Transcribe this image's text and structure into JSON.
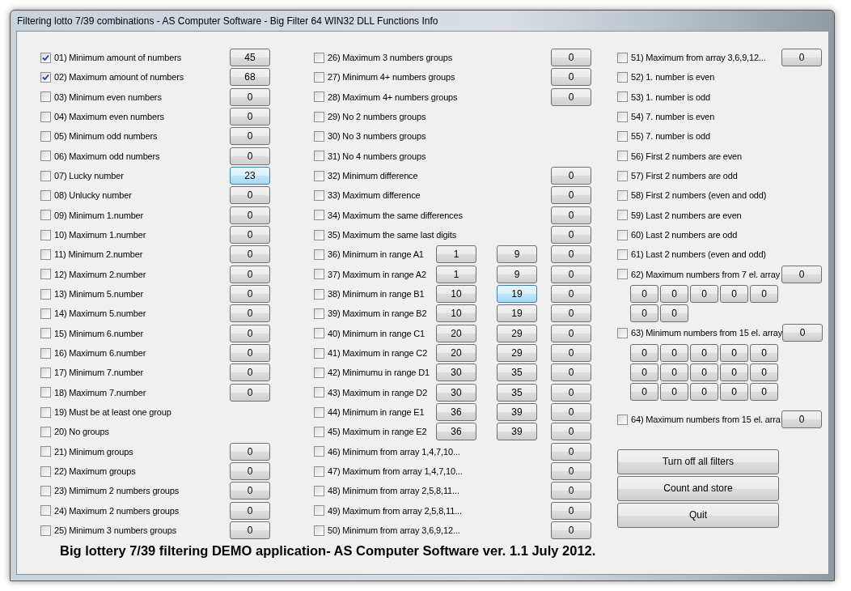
{
  "window": {
    "title": "Filtering lotto 7/39 combinations - AS Computer Software - Big Filter 64 WIN32 DLL Functions Info"
  },
  "columns": [
    {
      "items": [
        {
          "kind": "filter",
          "label": "01) Minimum amount of numbers",
          "checked": true,
          "values": [
            {
              "text": "45",
              "highlighted": false
            }
          ]
        },
        {
          "kind": "filter",
          "label": "02) Maximum amount of numbers",
          "checked": true,
          "values": [
            {
              "text": "68",
              "highlighted": false
            }
          ]
        },
        {
          "kind": "filter",
          "label": "03) Minimum even numbers",
          "checked": false,
          "values": [
            {
              "text": "0",
              "highlighted": false
            }
          ]
        },
        {
          "kind": "filter",
          "label": "04) Maximum even numbers",
          "checked": false,
          "values": [
            {
              "text": "0",
              "highlighted": false
            }
          ]
        },
        {
          "kind": "filter",
          "label": "05) Minimum odd numbers",
          "checked": false,
          "values": [
            {
              "text": "0",
              "highlighted": false
            }
          ]
        },
        {
          "kind": "filter",
          "label": "06) Maximum odd numbers",
          "checked": false,
          "values": [
            {
              "text": "0",
              "highlighted": false
            }
          ]
        },
        {
          "kind": "filter",
          "label": "07) Lucky number",
          "checked": false,
          "values": [
            {
              "text": "23",
              "highlighted": true
            }
          ]
        },
        {
          "kind": "filter",
          "label": "08) Unlucky number",
          "checked": false,
          "values": [
            {
              "text": "0",
              "highlighted": false
            }
          ]
        },
        {
          "kind": "filter",
          "label": "09) Minimum 1.number",
          "checked": false,
          "values": [
            {
              "text": "0",
              "highlighted": false
            }
          ]
        },
        {
          "kind": "filter",
          "label": "10) Maximum 1.number",
          "checked": false,
          "values": [
            {
              "text": "0",
              "highlighted": false
            }
          ]
        },
        {
          "kind": "filter",
          "label": "11) Minimum 2.number",
          "checked": false,
          "values": [
            {
              "text": "0",
              "highlighted": false
            }
          ]
        },
        {
          "kind": "filter",
          "label": "12) Maximum 2.number",
          "checked": false,
          "values": [
            {
              "text": "0",
              "highlighted": false
            }
          ]
        },
        {
          "kind": "filter",
          "label": "13) Minimum 5.number",
          "checked": false,
          "values": [
            {
              "text": "0",
              "highlighted": false
            }
          ]
        },
        {
          "kind": "filter",
          "label": "14) Maximum 5.number",
          "checked": false,
          "values": [
            {
              "text": "0",
              "highlighted": false
            }
          ]
        },
        {
          "kind": "filter",
          "label": "15) Minimum 6.number",
          "checked": false,
          "values": [
            {
              "text": "0",
              "highlighted": false
            }
          ]
        },
        {
          "kind": "filter",
          "label": "16) Maximum 6.number",
          "checked": false,
          "values": [
            {
              "text": "0",
              "highlighted": false
            }
          ]
        },
        {
          "kind": "filter",
          "label": "17) Minimum 7.number",
          "checked": false,
          "values": [
            {
              "text": "0",
              "highlighted": false
            }
          ]
        },
        {
          "kind": "filter",
          "label": "18) Maximum 7.number",
          "checked": false,
          "values": [
            {
              "text": "0",
              "highlighted": false
            }
          ]
        },
        {
          "kind": "filter",
          "label": "19) Must be at least one group",
          "checked": false
        },
        {
          "kind": "filter",
          "label": "20) No groups",
          "checked": false
        },
        {
          "kind": "filter",
          "label": "21) Minimum groups",
          "checked": false,
          "values": [
            {
              "text": "0",
              "highlighted": false
            }
          ]
        },
        {
          "kind": "filter",
          "label": "22) Maximum groups",
          "checked": false,
          "values": [
            {
              "text": "0",
              "highlighted": false
            }
          ]
        },
        {
          "kind": "filter",
          "label": "23) Mimimum 2 numbers groups",
          "checked": false,
          "values": [
            {
              "text": "0",
              "highlighted": false
            }
          ]
        },
        {
          "kind": "filter",
          "label": "24) Maximum 2 numbers groups",
          "checked": false,
          "values": [
            {
              "text": "0",
              "highlighted": false
            }
          ]
        },
        {
          "kind": "filter",
          "label": "25) Minimum 3 numbers groups",
          "checked": false,
          "values": [
            {
              "text": "0",
              "highlighted": false
            }
          ]
        }
      ]
    },
    {
      "items": [
        {
          "kind": "filter",
          "label": "26) Maximum 3 numbers groups",
          "checked": false,
          "values": [
            {
              "text": "0",
              "highlighted": false
            }
          ]
        },
        {
          "kind": "filter",
          "label": "27) Minimum 4+ numbers groups",
          "checked": false,
          "values": [
            {
              "text": "0",
              "highlighted": false
            }
          ]
        },
        {
          "kind": "filter",
          "label": "28) Maximum 4+ numbers groups",
          "checked": false,
          "values": [
            {
              "text": "0",
              "highlighted": false
            }
          ]
        },
        {
          "kind": "filter",
          "label": "29) No 2 numbers groups",
          "checked": false
        },
        {
          "kind": "filter",
          "label": "30) No 3 numbers groups",
          "checked": false
        },
        {
          "kind": "filter",
          "label": "31) No 4 numbers groups",
          "checked": false
        },
        {
          "kind": "filter",
          "label": "32) Minimum difference",
          "checked": false,
          "values": [
            {
              "text": "0",
              "highlighted": false
            }
          ]
        },
        {
          "kind": "filter",
          "label": "33) Maximum difference",
          "checked": false,
          "values": [
            {
              "text": "0",
              "highlighted": false
            }
          ]
        },
        {
          "kind": "filter",
          "label": "34) Maximum the same differences",
          "checked": false,
          "values": [
            {
              "text": "0",
              "highlighted": false
            }
          ]
        },
        {
          "kind": "filter",
          "label": "35) Maximum the same last digits",
          "checked": false,
          "values": [
            {
              "text": "0",
              "highlighted": false
            }
          ]
        },
        {
          "kind": "filter",
          "label": "36) Minimum in range A1",
          "checked": false,
          "values": [
            {
              "text": "1",
              "highlighted": false
            },
            {
              "text": "9",
              "highlighted": false
            },
            {
              "text": "0",
              "highlighted": false
            }
          ]
        },
        {
          "kind": "filter",
          "label": "37) Maximum in range A2",
          "checked": false,
          "values": [
            {
              "text": "1",
              "highlighted": false
            },
            {
              "text": "9",
              "highlighted": false
            },
            {
              "text": "0",
              "highlighted": false
            }
          ]
        },
        {
          "kind": "filter",
          "label": "38) Minimum in range B1",
          "checked": false,
          "values": [
            {
              "text": "10",
              "highlighted": false
            },
            {
              "text": "19",
              "highlighted": true
            },
            {
              "text": "0",
              "highlighted": false
            }
          ]
        },
        {
          "kind": "filter",
          "label": "39) Maximum in range B2",
          "checked": false,
          "values": [
            {
              "text": "10",
              "highlighted": false
            },
            {
              "text": "19",
              "highlighted": false
            },
            {
              "text": "0",
              "highlighted": false
            }
          ]
        },
        {
          "kind": "filter",
          "label": "40) Minimum in range C1",
          "checked": false,
          "values": [
            {
              "text": "20",
              "highlighted": false
            },
            {
              "text": "29",
              "highlighted": false
            },
            {
              "text": "0",
              "highlighted": false
            }
          ]
        },
        {
          "kind": "filter",
          "label": "41) Maximum in range C2",
          "checked": false,
          "values": [
            {
              "text": "20",
              "highlighted": false
            },
            {
              "text": "29",
              "highlighted": false
            },
            {
              "text": "0",
              "highlighted": false
            }
          ]
        },
        {
          "kind": "filter",
          "label": "42) Minimumu in range D1",
          "checked": false,
          "values": [
            {
              "text": "30",
              "highlighted": false
            },
            {
              "text": "35",
              "highlighted": false
            },
            {
              "text": "0",
              "highlighted": false
            }
          ]
        },
        {
          "kind": "filter",
          "label": "43) Maximum in range D2",
          "checked": false,
          "values": [
            {
              "text": "30",
              "highlighted": false
            },
            {
              "text": "35",
              "highlighted": false
            },
            {
              "text": "0",
              "highlighted": false
            }
          ]
        },
        {
          "kind": "filter",
          "label": "44) Minimum in range E1",
          "checked": false,
          "values": [
            {
              "text": "36",
              "highlighted": false
            },
            {
              "text": "39",
              "highlighted": false
            },
            {
              "text": "0",
              "highlighted": false
            }
          ]
        },
        {
          "kind": "filter",
          "label": "45) Maximum in range E2",
          "checked": false,
          "values": [
            {
              "text": "36",
              "highlighted": false
            },
            {
              "text": "39",
              "highlighted": false
            },
            {
              "text": "0",
              "highlighted": false
            }
          ]
        },
        {
          "kind": "filter",
          "label": "46) Minimum from array 1,4,7,10...",
          "checked": false,
          "values": [
            {
              "text": "0",
              "highlighted": false
            }
          ]
        },
        {
          "kind": "filter",
          "label": "47) Maximum from array 1,4,7,10...",
          "checked": false,
          "values": [
            {
              "text": "0",
              "highlighted": false
            }
          ]
        },
        {
          "kind": "filter",
          "label": "48) Minimum from array 2,5,8,11...",
          "checked": false,
          "values": [
            {
              "text": "0",
              "highlighted": false
            }
          ]
        },
        {
          "kind": "filter",
          "label": "49) Maximum from array 2,5,8,11...",
          "checked": false,
          "values": [
            {
              "text": "0",
              "highlighted": false
            }
          ]
        },
        {
          "kind": "filter",
          "label": "50) Minimum from array 3,6,9,12...",
          "checked": false,
          "values": [
            {
              "text": "0",
              "highlighted": false
            }
          ]
        }
      ]
    },
    {
      "items": [
        {
          "kind": "filter",
          "label": "51) Maximum from array 3,6,9,12...",
          "checked": false,
          "values": [
            {
              "text": "0",
              "highlighted": false
            }
          ]
        },
        {
          "kind": "filter",
          "label": "52) 1. number is even",
          "checked": false
        },
        {
          "kind": "filter",
          "label": "53) 1. number is odd",
          "checked": false
        },
        {
          "kind": "filter",
          "label": "54) 7. number is even",
          "checked": false
        },
        {
          "kind": "filter",
          "label": "55) 7. number is odd",
          "checked": false
        },
        {
          "kind": "filter",
          "label": "56) First 2 numbers are even",
          "checked": false
        },
        {
          "kind": "filter",
          "label": "57) First 2 numbers are odd",
          "checked": false
        },
        {
          "kind": "filter",
          "label": "58) First 2 numbers (even and odd)",
          "checked": false
        },
        {
          "kind": "filter",
          "label": "59) Last 2 numbers are even",
          "checked": false
        },
        {
          "kind": "filter",
          "label": "60) Last 2 numbers are odd",
          "checked": false
        },
        {
          "kind": "filter",
          "label": "61) Last 2 numbers (even and odd)",
          "checked": false
        },
        {
          "kind": "filter",
          "label": "62) Maximum numbers from 7 el. array",
          "checked": false,
          "values": [
            {
              "text": "0",
              "highlighted": false
            }
          ]
        },
        {
          "kind": "array",
          "values": [
            "0",
            "0",
            "0",
            "0",
            "0",
            "0",
            "0"
          ]
        },
        {
          "kind": "filter",
          "label": "63) Minimum numbers from 15 el. array",
          "checked": false,
          "values": [
            {
              "text": "0",
              "highlighted": false
            }
          ]
        },
        {
          "kind": "array",
          "values": [
            "0",
            "0",
            "0",
            "0",
            "0",
            "0",
            "0",
            "0",
            "0",
            "0",
            "0",
            "0",
            "0",
            "0",
            "0"
          ]
        },
        {
          "kind": "filter",
          "label": "64) Maximum numbers from 15 el. arra",
          "checked": false,
          "values": [
            {
              "text": "0",
              "highlighted": false
            }
          ]
        }
      ]
    }
  ],
  "buttons": [
    "Turn off all filters",
    "Count and store",
    "Quit"
  ],
  "footer": "Big lottery 7/39 filtering DEMO application- AS Computer Software ver. 1.1 July 2012."
}
